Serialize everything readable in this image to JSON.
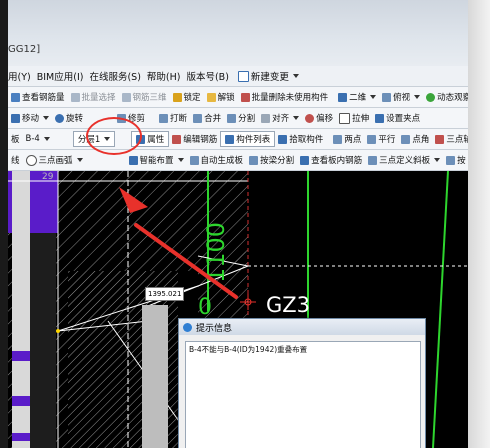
{
  "window": {
    "title": "GG12]"
  },
  "menu": {
    "items": [
      "用(Y)",
      "BIM应用(I)",
      "在线服务(S)",
      "帮助(H)",
      "版本号(B)",
      "新建变更"
    ]
  },
  "toolbar1": {
    "items": [
      "查看钢筋量",
      "批量选择",
      "钢筋三维",
      "锁定",
      "解锁",
      "批量删除未使用构件",
      "二维",
      "俯视",
      "动态观察"
    ]
  },
  "toolbar2": {
    "items": [
      "移动",
      "旋转",
      "修剪",
      "打断",
      "合并",
      "分割",
      "对齐",
      "偏移",
      "拉伸",
      "设置夹点"
    ]
  },
  "toolbar3": {
    "slab_label": "板",
    "slab_value": "B-4",
    "layer_value": "分层1",
    "items": [
      "属性",
      "编辑钢筋",
      "构件列表",
      "拾取构件",
      "两点",
      "平行",
      "点角",
      "三点辅"
    ]
  },
  "toolbar4": {
    "items": [
      "线",
      "三点画弧",
      "智能布置",
      "自动生成板",
      "按梁分割",
      "查看板内钢筋",
      "三点定义斜板",
      "按"
    ]
  },
  "canvas": {
    "grid_number": "29",
    "dimension_text": "1100",
    "zero_label": "0",
    "column_label": "GZ3",
    "coord_tooltip": "1395.021"
  },
  "dialog": {
    "title": "提示信息",
    "message": "B-4不能与B-4(ID为1942)重叠布置"
  },
  "colors": {
    "annotation": "#e8312b",
    "grid_green": "#2ed52e",
    "purple_panel": "#5a1cc9"
  }
}
